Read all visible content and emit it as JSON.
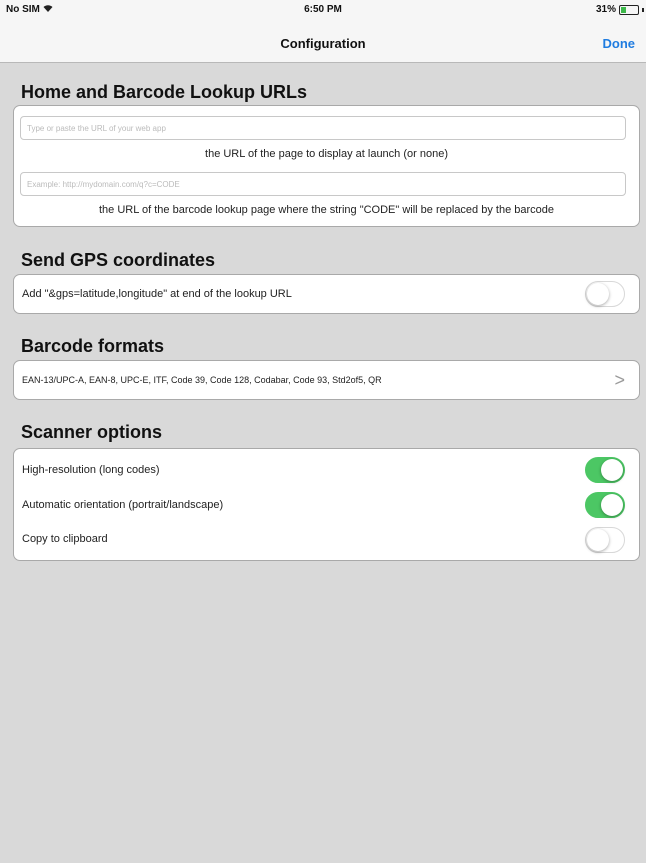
{
  "status_bar": {
    "carrier": "No SIM",
    "time": "6:50 PM",
    "battery": "31%",
    "battery_level": 0.31,
    "wifi_icon": "wifi-icon",
    "battery_icon": "battery-icon"
  },
  "nav": {
    "title": "Configuration",
    "done_label": "Done",
    "accent_color": "#1f7ce0"
  },
  "sections": {
    "urls": {
      "title": "Home and Barcode Lookup URLs",
      "home_url": {
        "value": "",
        "placeholder": "Type or paste the URL of your web app"
      },
      "home_caption": "the URL of the page to display at launch (or none)",
      "lookup_url": {
        "value": "",
        "placeholder": "Example: http://mydomain.com/q?c=CODE"
      },
      "lookup_caption": "the URL of the barcode lookup page where the string \"CODE\" will be replaced by the barcode"
    },
    "gps": {
      "title": "Send GPS coordinates",
      "label": "Add \"&gps=latitude,longitude\" at end of the lookup URL",
      "enabled": false
    },
    "formats": {
      "title": "Barcode formats",
      "value": "EAN-13/UPC-A, EAN-8, UPC-E, ITF, Code 39, Code 128, Codabar, Code 93, Std2of5, QR",
      "chevron": ">"
    },
    "scanner": {
      "title": "Scanner options",
      "options": [
        {
          "label": "High-resolution (long codes)",
          "enabled": true
        },
        {
          "label": "Automatic orientation (portrait/landscape)",
          "enabled": true
        },
        {
          "label": "Copy to clipboard",
          "enabled": false
        }
      ]
    }
  },
  "colors": {
    "toggle_on": "#4cc764",
    "background": "#d9d9d9"
  }
}
